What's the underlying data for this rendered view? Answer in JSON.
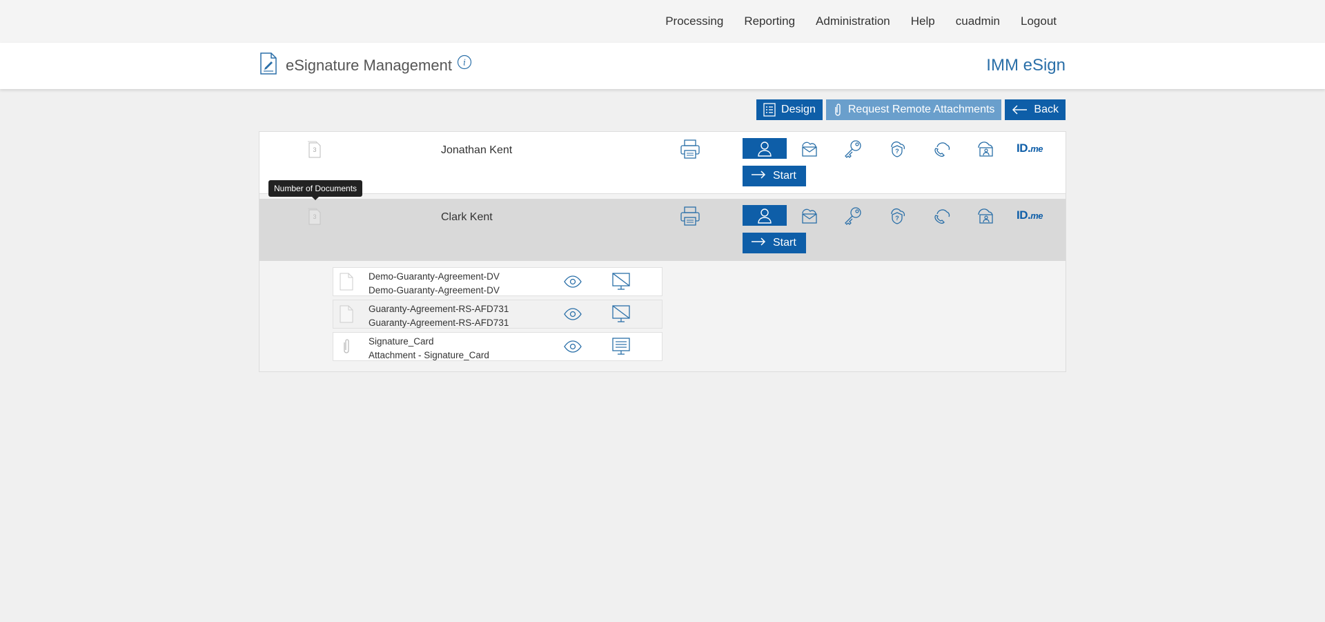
{
  "nav": {
    "items": [
      "Processing",
      "Reporting",
      "Administration",
      "Help",
      "cuadmin",
      "Logout"
    ]
  },
  "header": {
    "title": "eSignature Management",
    "brand": "IMM eSign"
  },
  "toolbar": {
    "design_label": "Design",
    "request_label": "Request Remote Attachments",
    "back_label": "Back"
  },
  "signers": [
    {
      "name": "Jonathan Kent",
      "doc_count": "3",
      "start_label": "Start"
    },
    {
      "name": "Clark Kent",
      "doc_count": "3",
      "start_label": "Start"
    }
  ],
  "auth_methods": [
    "in-person-icon",
    "email-icon",
    "password-key-icon",
    "kba-question-icon",
    "phone-icon",
    "remote-id-icon",
    "idme-logo"
  ],
  "idme": {
    "main": "ID.",
    "suffix": "me"
  },
  "tooltip": "Number of Documents",
  "documents": [
    {
      "line1": "Demo-Guaranty-Agreement-DV",
      "line2": "Demo-Guaranty-Agreement-DV",
      "type": "document"
    },
    {
      "line1": "Guaranty-Agreement-RS-AFD731",
      "line2": "Guaranty-Agreement-RS-AFD731",
      "type": "document"
    },
    {
      "line1": "Signature_Card",
      "line2": "Attachment - Signature_Card",
      "type": "attachment"
    }
  ],
  "colors": {
    "primary": "#0e5ea8",
    "primary_light": "#6a9fcc",
    "brand_text": "#2a6fa8"
  }
}
